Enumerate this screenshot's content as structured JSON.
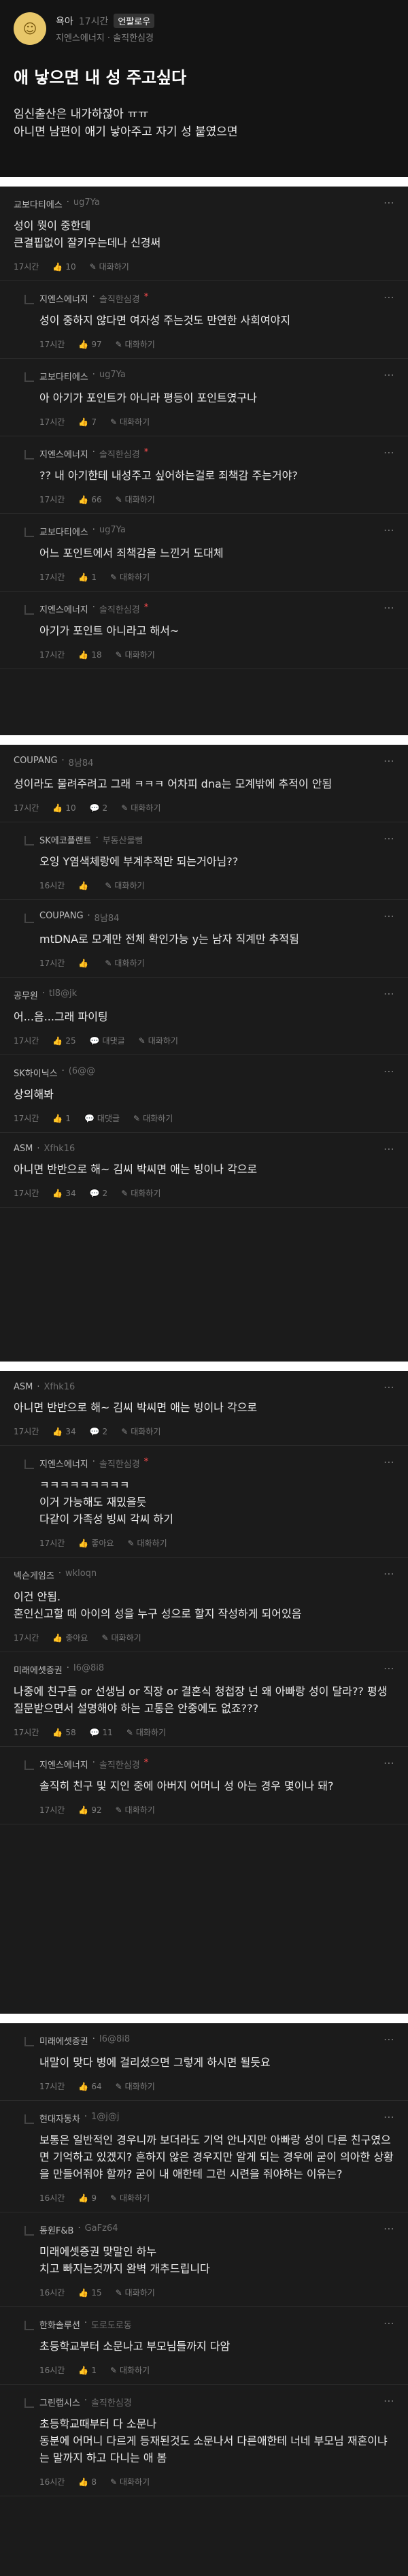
{
  "post": {
    "author": "욕아",
    "time": "17시간",
    "category": "언팔로우",
    "company": "지엔스에너지 · 솔직한심경",
    "title": "애 낳으면 내 성 주고싶다",
    "body_line1": "임신출산은 내가하잖아 ㅠㅠ",
    "body_line2": "아니면 남편이 애기 낳아주고 자기 성 붙였으면"
  },
  "action_like": "좋아요",
  "action_reply": "대화하기",
  "panel1": [
    {
      "name": "교보다티에스",
      "job": "ug7Ya",
      "text": "성이 뭣이 중한데\n큰결핍없이 잘키우는데나 신경써",
      "time": "17시간",
      "likes": "10",
      "reply": "대화하기",
      "is_reply": false
    },
    {
      "name": "지엔스에너지",
      "job": "솔직한심경",
      "text": "성이 중하지 않다면 여자성 주는것도 만연한 사회여야지",
      "time": "17시간",
      "likes": "97",
      "reply": "대화하기",
      "is_reply": true
    },
    {
      "name": "교보다티에스",
      "job": "ug7Ya",
      "text": "아 아기가 포인트가 아니라 평등이 포인트였구나",
      "time": "17시간",
      "likes": "7",
      "reply": "대화하기",
      "is_reply": true
    },
    {
      "name": "지엔스에너지",
      "job": "솔직한심경",
      "text": "?? 내 아기한테 내성주고 싶어하는걸로 죄책감 주는거야?",
      "time": "17시간",
      "likes": "66",
      "reply": "대화하기",
      "is_reply": true
    },
    {
      "name": "교보다티에스",
      "job": "ug7Ya",
      "text": "어느 포인트에서 죄책감을 느낀거 도대체",
      "time": "17시간",
      "likes": "1",
      "reply": "대화하기",
      "is_reply": true
    },
    {
      "name": "지엔스에너지",
      "job": "솔직한심경",
      "text": "아기가 포인트 아니라고 해서~",
      "time": "17시간",
      "likes": "18",
      "reply": "대화하기",
      "is_reply": true
    }
  ],
  "panel2": [
    {
      "name": "COUPANG",
      "job": "8남84",
      "text": "성이라도 물려주려고 그래 ㅋㅋㅋ 어차피 dna는 모계밖에 추적이 안됨",
      "time": "17시간",
      "likes": "10",
      "comments": "2",
      "reply": "대화하기",
      "is_reply": false
    },
    {
      "name": "SK에코플랜트",
      "job": "부동산물뻥",
      "text": "오잉 Y염색체랑에 부계추적만 되는거아님??",
      "time": "16시간",
      "likes": "",
      "comments": "",
      "reply": "대화하기",
      "is_reply": true
    },
    {
      "name": "COUPANG",
      "job": "8남84",
      "text": "mtDNA로 모계만 전체 확인가능 y는 남자 직계만 추적됨",
      "time": "17시간",
      "likes": "",
      "comments": "",
      "reply": "대화하기",
      "is_reply": true
    },
    {
      "name": "공무원",
      "job": "tl8@jk",
      "text": "어...음...그래 파이팅",
      "time": "17시간",
      "likes": "25",
      "comments": "대댓글",
      "reply": "대화하기",
      "is_reply": false
    },
    {
      "name": "SK하이닉스",
      "job": "(6@@",
      "text": "상의해봐",
      "time": "17시간",
      "likes": "1",
      "comments": "대댓글",
      "reply": "대화하기",
      "is_reply": false
    },
    {
      "name": "ASM",
      "job": "Xfhk16",
      "text": "아니면 반반으로 해~ 김씨 박씨면 애는 빙이나 각으로",
      "time": "17시간",
      "likes": "34",
      "comments": "2",
      "reply": "대화하기",
      "is_reply": false
    }
  ],
  "panel3": [
    {
      "name": "ASM",
      "job": "Xfhk16",
      "text": "아니면 반반으로 해~ 김씨 박씨면 애는 빙이나 각으로",
      "time": "17시간",
      "likes": "34",
      "comments": "2",
      "reply": "대화하기",
      "is_reply": false
    },
    {
      "name": "지엔스에너지",
      "job": "솔직한심경",
      "text": "ㅋㅋㅋㅋㅋㅋㅋㅋㅋ\n이거 가능해도 재밌을듯\n다같이 가족성 빙씨 각씨 하기",
      "time": "17시간",
      "likes": "좋아요",
      "comments": "",
      "reply": "대화하기",
      "is_reply": true
    },
    {
      "name": "넥슨게임즈",
      "job": "wkloqn",
      "text": "이건 안됨.\n혼인신고할 때 아이의 성을 누구 성으로 할지 작성하게 되어있음",
      "time": "17시간",
      "likes": "좋아요",
      "comments": "",
      "reply": "대화하기",
      "is_reply": false
    },
    {
      "name": "미래에셋증권",
      "job": "I6@8i8",
      "text": "나중에 친구들 or 선생님 or 직장 or 결혼식 청첩장 넌 왜 아빠랑 성이 달라?? 평생 질문받으면서 설명해야 하는 고통은 안중에도 없죠???",
      "time": "17시간",
      "likes": "58",
      "comments": "11",
      "reply": "대화하기",
      "is_reply": false
    },
    {
      "name": "지엔스에너지",
      "job": "솔직한심경",
      "text": "솔직히 친구 및 지인 중에 아버지 어머니 성 아는 경우 몇이나 돼?",
      "time": "17시간",
      "likes": "92",
      "comments": "",
      "reply": "대화하기",
      "is_reply": true
    }
  ],
  "panel4": [
    {
      "name": "미래에셋증권",
      "job": "I6@8i8",
      "text": "내말이 맞다 병에 걸리셨으면 그렇게 하시면 될듯요",
      "time": "17시간",
      "likes": "64",
      "comments": "",
      "reply": "대화하기",
      "is_reply": true
    },
    {
      "name": "현대자동차",
      "job": "1@j@j",
      "text": "보통은 일반적인 경우니까 보더라도 기억 안나지만 아빠랑 성이 다른 친구였으면 기억하고 있겠지? 흔하지 않은 경우지만 알게 되는 경우에 굳이 의아한 상황을 만들어줘야 할까? 굳이 내 애한테 그런 시련을 줘야하는 이유는?",
      "time": "16시간",
      "likes": "9",
      "comments": "",
      "reply": "대화하기",
      "is_reply": true
    },
    {
      "name": "동원F&B",
      "job": "GaFz64",
      "text": "미래에셋증권 맞말인 하누\n치고 빠지는것까지 완벽 개추드립니다",
      "time": "16시간",
      "likes": "15",
      "comments": "",
      "reply": "대화하기",
      "is_reply": true
    },
    {
      "name": "한화솔루션",
      "job": "도로도로동",
      "text": "초등학교부터 소문나고 부모님들까지 다암",
      "time": "16시간",
      "likes": "1",
      "comments": "",
      "reply": "대화하기",
      "is_reply": true
    },
    {
      "name": "그린랩시스",
      "job": "솔직한심경",
      "text": "초등학교때부터 다 소문나\n동분에 어머니 다르게 등재된것도 소문나서 다른애한테 너네 부모님 재혼이냐는 말까지 하고 다니는 애 봄",
      "time": "16시간",
      "likes": "8",
      "comments": "",
      "reply": "대화하기",
      "is_reply": true
    }
  ]
}
